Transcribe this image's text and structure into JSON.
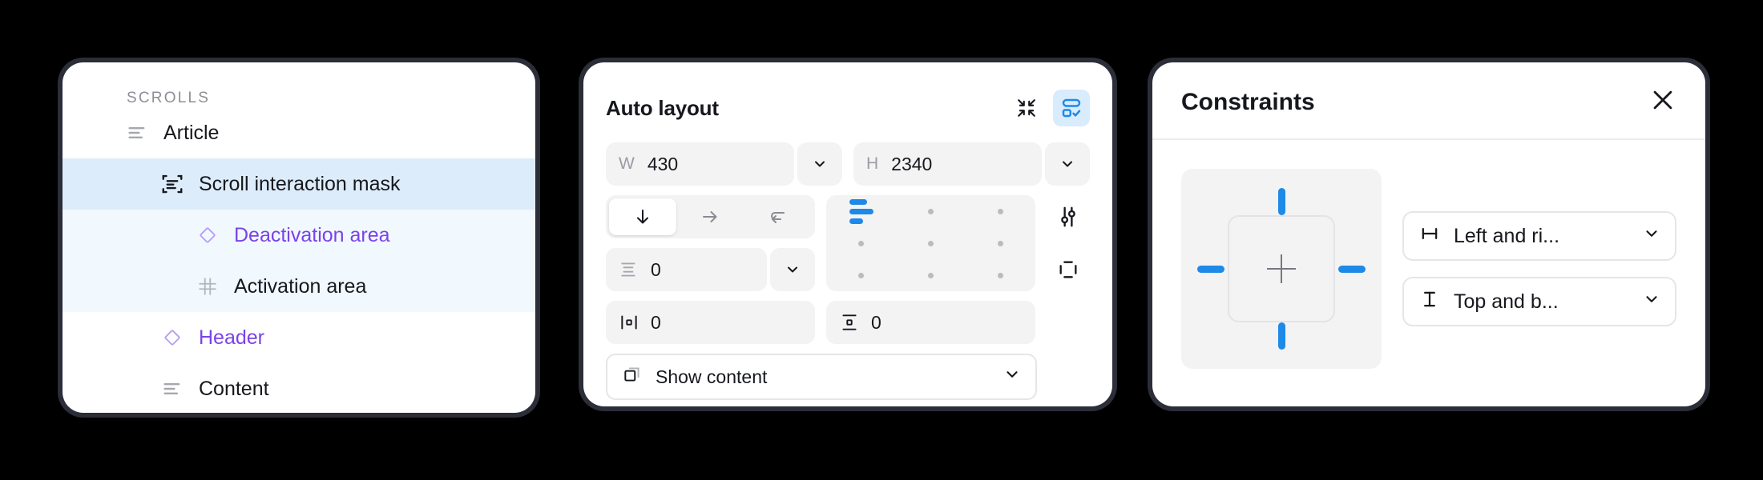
{
  "layers_panel": {
    "section_title": "SCROLLS",
    "rows": [
      {
        "label": "Article",
        "icon": "text-align-left-icon",
        "indent": 0,
        "color": "default",
        "state": "normal"
      },
      {
        "label": "Scroll interaction mask",
        "icon": "mask-icon",
        "indent": 1,
        "color": "default",
        "state": "selected"
      },
      {
        "label": "Deactivation area",
        "icon": "component-diamond-icon",
        "indent": 2,
        "color": "purple",
        "state": "group"
      },
      {
        "label": "Activation area",
        "icon": "grid-hash-icon",
        "indent": 2,
        "color": "default",
        "state": "group"
      },
      {
        "label": "Header",
        "icon": "component-diamond-icon",
        "indent": 1,
        "color": "purple",
        "state": "normal"
      },
      {
        "label": "Content",
        "icon": "text-align-left-icon",
        "indent": 1,
        "color": "default",
        "state": "normal"
      }
    ],
    "colors": {
      "selected_row": "#ddecfa",
      "group_background": "#f1f8fe",
      "purple_text": "#7b42e8",
      "section_title": "#8d8f96"
    }
  },
  "auto_layout_panel": {
    "title": "Auto layout",
    "header_icons": [
      {
        "name": "resize-to-fit-icon",
        "active": false
      },
      {
        "name": "auto-layout-preview-icon",
        "active": true
      }
    ],
    "width_field": {
      "prefix": "W",
      "value": "430"
    },
    "height_field": {
      "prefix": "H",
      "value": "2340"
    },
    "direction": {
      "options": [
        {
          "name": "direction-vertical-icon",
          "selected": true
        },
        {
          "name": "direction-horizontal-icon",
          "selected": false
        },
        {
          "name": "direction-wrap-icon",
          "selected": false
        }
      ]
    },
    "gap_field": {
      "icon": "gap-vertical-icon",
      "value": "0"
    },
    "padding_horizontal_field": {
      "icon": "padding-horizontal-icon",
      "value": "0"
    },
    "padding_vertical_field": {
      "icon": "padding-vertical-icon",
      "value": "0"
    },
    "alignment": {
      "selected_cell": 0,
      "rows": 3,
      "cols": 3,
      "accent": "#1d8ae8"
    },
    "side_icons": [
      {
        "name": "advanced-layout-settings-icon"
      },
      {
        "name": "individual-padding-icon"
      }
    ],
    "show_content_dropdown": {
      "icon": "clip-content-icon",
      "label": "Show content"
    }
  },
  "constraints_panel": {
    "title": "Constraints",
    "close_icon": "close-icon",
    "pad": {
      "horizontal_constraint_active": true,
      "vertical_constraint_active": true,
      "accent": "#1d8ae8"
    },
    "horizontal_select": {
      "icon": "horizontal-constraint-icon",
      "value": "Left and ri..."
    },
    "vertical_select": {
      "icon": "vertical-constraint-icon",
      "value": "Top and b..."
    }
  }
}
